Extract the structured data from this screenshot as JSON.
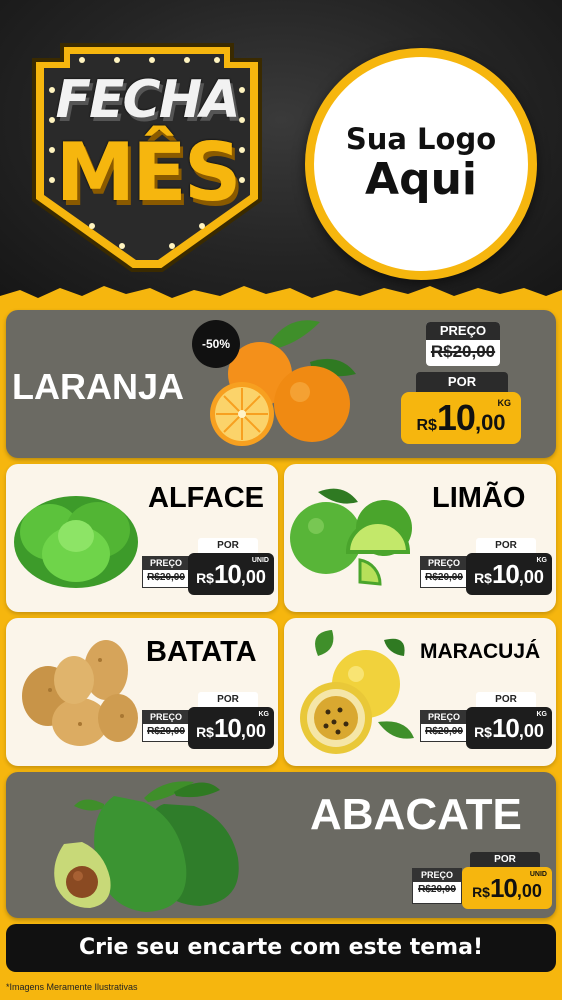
{
  "header": {
    "badge_line1": "FECHA",
    "badge_line2": "MÊS",
    "logo_line1": "Sua Logo",
    "logo_line2": "Aqui"
  },
  "featured": {
    "name": "LARANJA",
    "discount": "-50%",
    "price_label": "PREÇO",
    "old_price": "R$20,00",
    "por_label": "POR",
    "currency": "R$",
    "price_int": "10",
    "price_cents": ",00",
    "unit": "KG"
  },
  "products": [
    {
      "name": "ALFACE",
      "price_label": "PREÇO",
      "old_price": "R$20,00",
      "por_label": "POR",
      "currency": "R$",
      "price_int": "10",
      "price_cents": ",00",
      "unit": "UNID"
    },
    {
      "name": "LIMÃO",
      "price_label": "PREÇO",
      "old_price": "R$20,00",
      "por_label": "POR",
      "currency": "R$",
      "price_int": "10",
      "price_cents": ",00",
      "unit": "KG"
    },
    {
      "name": "BATATA",
      "price_label": "PREÇO",
      "old_price": "R$20,00",
      "por_label": "POR",
      "currency": "R$",
      "price_int": "10",
      "price_cents": ",00",
      "unit": "KG"
    },
    {
      "name": "MARACUJÁ",
      "price_label": "PREÇO",
      "old_price": "R$20,00",
      "por_label": "POR",
      "currency": "R$",
      "price_int": "10",
      "price_cents": ",00",
      "unit": "KG"
    }
  ],
  "bottom_product": {
    "name": "ABACATE",
    "price_label": "PREÇO",
    "old_price": "R$20,00",
    "por_label": "POR",
    "currency": "R$",
    "price_int": "10",
    "price_cents": ",00",
    "unit": "UNID"
  },
  "cta": "Crie seu encarte com este tema!",
  "footnote": "*Imagens Meramente Ilustrativas",
  "colors": {
    "accent": "#f6b60e",
    "dark": "#1d1d1d",
    "card_dark": "#6b6a63",
    "card_light": "#fbf5ea"
  }
}
